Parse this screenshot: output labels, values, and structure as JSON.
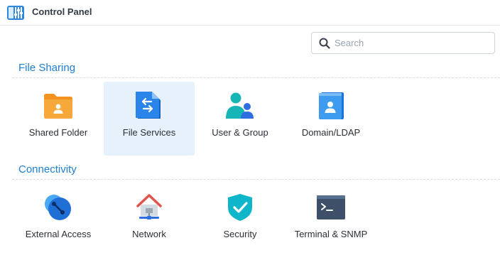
{
  "window": {
    "title": "Control Panel"
  },
  "search": {
    "placeholder": "Search",
    "value": ""
  },
  "sections": [
    {
      "title": "File Sharing",
      "items": [
        {
          "label": "Shared Folder",
          "icon": "shared-folder-icon"
        },
        {
          "label": "File Services",
          "icon": "file-services-icon",
          "selected": true
        },
        {
          "label": "User & Group",
          "icon": "user-group-icon"
        },
        {
          "label": "Domain/LDAP",
          "icon": "domain-ldap-icon"
        }
      ]
    },
    {
      "title": "Connectivity",
      "items": [
        {
          "label": "External Access",
          "icon": "external-access-icon"
        },
        {
          "label": "Network",
          "icon": "network-icon"
        },
        {
          "label": "Security",
          "icon": "security-shield-icon"
        },
        {
          "label": "Terminal & SNMP",
          "icon": "terminal-icon"
        }
      ]
    }
  ],
  "colors": {
    "section_title": "#1e7fd1",
    "selected_tile": "#e6f1fc",
    "folder_orange": "#f59a2a",
    "file_blue": "#1a73e8",
    "teal": "#19b8b8",
    "security_teal": "#0fb5c9",
    "network_red": "#e0534a",
    "terminal_slate": "#4a5f77"
  }
}
